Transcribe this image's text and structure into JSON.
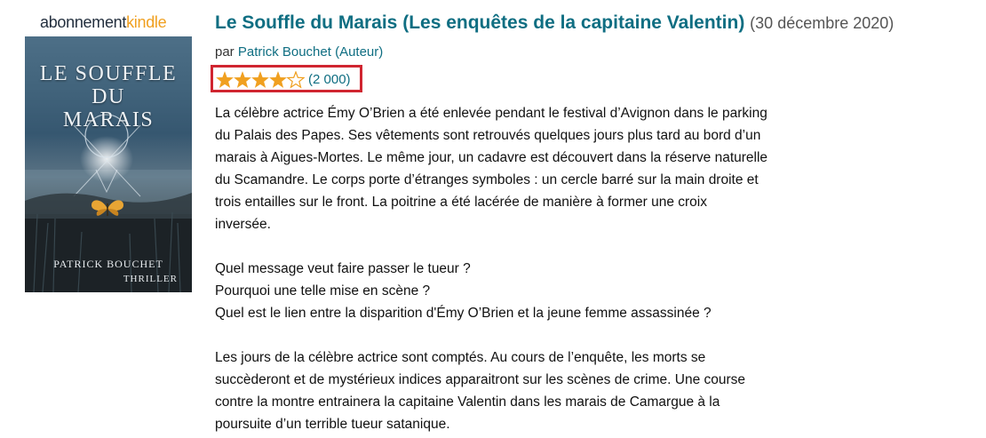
{
  "badge": {
    "part1": "abonnement",
    "part2": "kindle"
  },
  "cover": {
    "title_lines": [
      "LE SOUFFLE",
      "DU",
      "MARAIS"
    ],
    "author": "PATRICK BOUCHET",
    "genre": "THRILLER"
  },
  "product": {
    "title": "Le Souffle du Marais (Les enquêtes de la capitaine Valentin)",
    "date": "(30 décembre 2020)",
    "author_prefix": "par",
    "author": "Patrick Bouchet (Auteur)"
  },
  "rating": {
    "stars": 4,
    "max_stars": 5,
    "count": "(2 000)",
    "star_color": "#f0a020",
    "highlight_color": "#d02530"
  },
  "description": {
    "p1": [
      "La célèbre actrice Émy O’Brien a été enlevée pendant le festival d’Avignon dans le parking",
      "du Palais des Papes. Ses vêtements sont retrouvés quelques jours plus tard au bord d’un",
      "marais à Aigues-Mortes. Le même jour, un cadavre est découvert dans la réserve naturelle",
      "du Scamandre. Le corps porte d’étranges symboles : un cercle barré sur la main droite et",
      "trois entailles sur le front. La poitrine a été lacérée de manière à former une croix",
      "inversée."
    ],
    "p2": [
      "Quel message veut faire passer le tueur ?",
      "Pourquoi une telle mise en scène ?",
      "Quel est le lien entre la disparition d'Émy O’Brien et la jeune femme assassinée ?"
    ],
    "p3": [
      "Les jours de la célèbre actrice sont comptés. Au cours de l’enquête, les morts se",
      "succèderont et de mystérieux indices apparaitront sur les scènes de crime. Une course",
      "contre la montre entrainera la capitaine Valentin dans les marais de Camargue à la",
      "poursuite d’un terrible tueur satanique."
    ]
  }
}
